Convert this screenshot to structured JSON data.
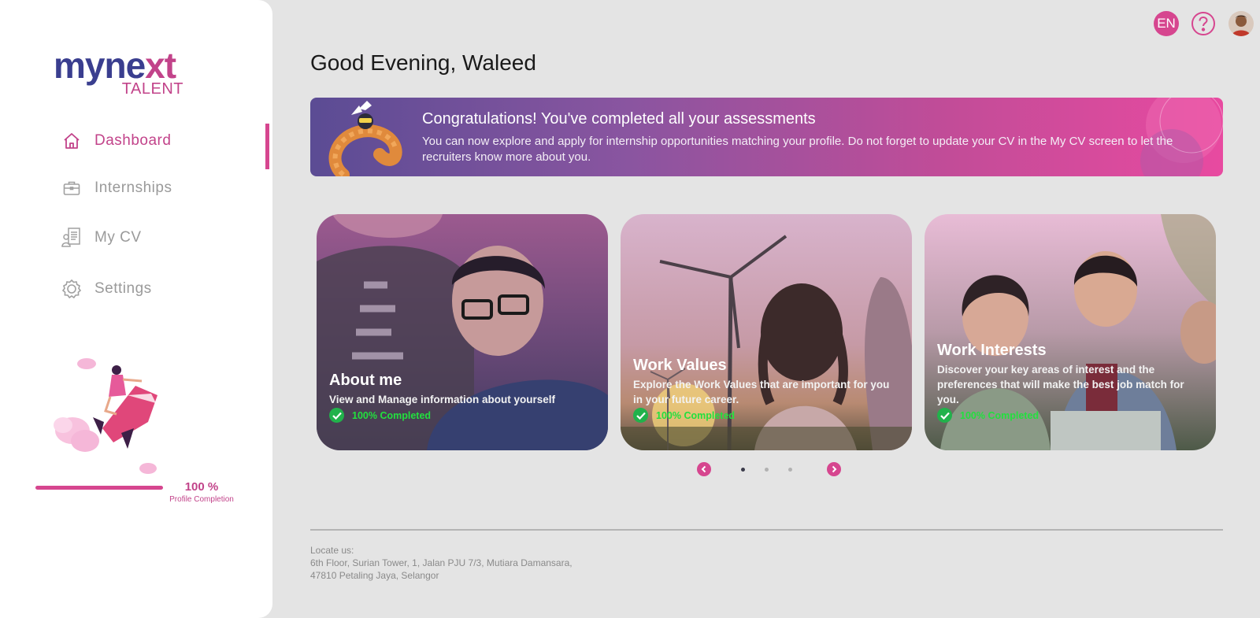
{
  "brand": {
    "logo_word_a": "myne",
    "logo_word_b": "xt",
    "logo_sub": "TALENT"
  },
  "sidebar": {
    "items": [
      {
        "label": "Dashboard",
        "icon": "home-icon",
        "active": true
      },
      {
        "label": "Internships",
        "icon": "briefcase-icon",
        "active": false
      },
      {
        "label": "My CV",
        "icon": "cv-document-icon",
        "active": false
      },
      {
        "label": "Settings",
        "icon": "gear-icon",
        "active": false
      }
    ],
    "profile": {
      "percent_label": "100 %",
      "label": "Profile Completion",
      "completion": 1.0
    }
  },
  "topbar": {
    "language": "EN",
    "help_icon": "question-icon",
    "avatar_icon": "user-avatar"
  },
  "greeting": "Good Evening, Waleed",
  "banner": {
    "title": "Congratulations! You've completed all your assessments",
    "text": "You can now explore and apply for internship opportunities matching your profile. Do not forget to update your CV in the My CV screen to let the recruiters know more about you."
  },
  "cards": [
    {
      "title": "About me",
      "description": "View and Manage information about yourself",
      "status": "100% Completed"
    },
    {
      "title": "Work Values",
      "description": "Explore the Work Values that are important for you in your future career.",
      "status": "100% Completed"
    },
    {
      "title": "Work Interests",
      "description": "Discover your key areas of interest and the preferences that will make the best job match for you.",
      "status": "100% Completed"
    }
  ],
  "carousel": {
    "pages": 3,
    "current": 1
  },
  "footer": {
    "heading": "Locate us:",
    "address_line1": "6th Floor, Surian Tower, 1, Jalan PJU 7/3, Mutiara Damansara,",
    "address_line2": "47810 Petaling Jaya, Selangor"
  },
  "colors": {
    "accent": "#d6468f",
    "brand_dark": "#3a3e8f",
    "success": "#21b24b",
    "background": "#e4e4e4"
  }
}
